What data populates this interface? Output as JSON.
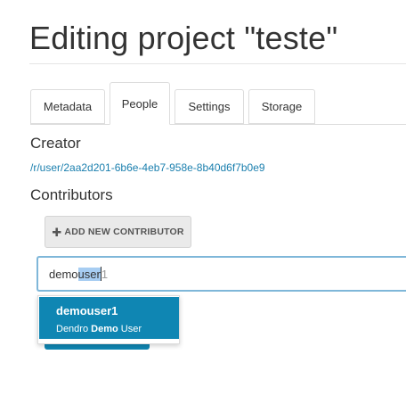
{
  "header": {
    "title": "Editing project \"teste\""
  },
  "tabs": [
    {
      "label": "Metadata",
      "active": false
    },
    {
      "label": "People",
      "active": true
    },
    {
      "label": "Settings",
      "active": false
    },
    {
      "label": "Storage",
      "active": false
    }
  ],
  "creator": {
    "heading": "Creator",
    "link": "/r/user/2aa2d201-6b6e-4eb7-958e-8b40d6f7b0e9"
  },
  "contributors": {
    "heading": "Contributors",
    "add_button_icon": "plus-icon",
    "add_button_label": "ADD NEW CONTRIBUTOR",
    "search": {
      "typed": "demo",
      "selected": "user",
      "autocomplete_hint": "1"
    },
    "suggestions": [
      {
        "username": "demouser1",
        "fullname_before": "Dendro ",
        "fullname_match": "Demo",
        "fullname_after": " User"
      }
    ]
  },
  "colors": {
    "accent": "#0f86b3",
    "link": "#1a7fae",
    "input_focus_border": "#7fb7d9",
    "selection": "#a7cdf2"
  }
}
